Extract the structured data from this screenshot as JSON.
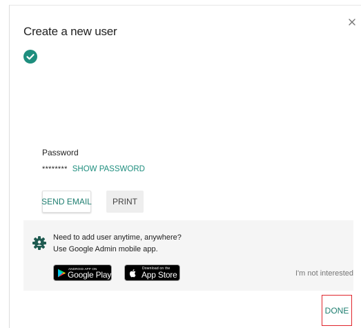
{
  "dialog": {
    "title": "Create a new user",
    "close_icon": "close-icon",
    "status_icon": "check-circle-icon"
  },
  "password": {
    "label": "Password",
    "masked_value": "********",
    "show_label": "SHOW PASSWORD"
  },
  "actions": {
    "send_email_label": "SEND EMAIL",
    "print_label": "PRINT"
  },
  "promo": {
    "icon": "admin-gear-icon",
    "line1": "Need to add user anytime, anywhere?",
    "line2": "Use Google Admin mobile app.",
    "google_play": {
      "small": "ANDROID APP ON",
      "big": "Google Play"
    },
    "app_store": {
      "small": "Download on the",
      "big": "App Store"
    },
    "dismiss_label": "I'm not interested"
  },
  "footer": {
    "done_label": "DONE"
  },
  "colors": {
    "accent": "#1e8e7e",
    "highlight_border": "#e0242b",
    "promo_bg": "#f5f5f5"
  }
}
